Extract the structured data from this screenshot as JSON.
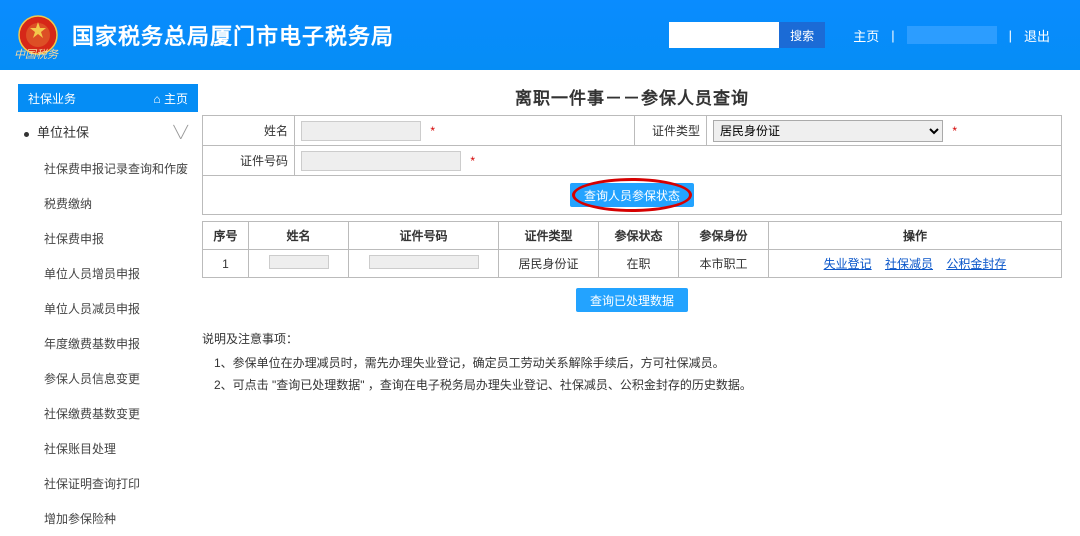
{
  "header": {
    "site_title": "国家税务总局厦门市电子税务局",
    "logo_sub": "中国税务",
    "search_placeholder": "",
    "search_btn": "搜索",
    "nav_home": "主页",
    "nav_logout": "退出"
  },
  "sidebar": {
    "head_label": "社保业务",
    "head_home": "主页",
    "top_item": "单位社保",
    "items": [
      "社保费申报记录查询和作废",
      "税费缴纳",
      "社保费申报",
      "单位人员增员申报",
      "单位人员减员申报",
      "年度缴费基数申报",
      "参保人员信息变更",
      "社保缴费基数变更",
      "社保账目处理",
      "社保证明查询打印",
      "增加参保险种"
    ]
  },
  "page": {
    "title": "离职一件事－－参保人员查询"
  },
  "form": {
    "name_label": "姓名",
    "idtype_label": "证件类型",
    "idtype_value": "居民身份证",
    "idno_label": "证件号码",
    "query_btn": "查询人员参保状态"
  },
  "table": {
    "cols": [
      "序号",
      "姓名",
      "证件号码",
      "证件类型",
      "参保状态",
      "参保身份",
      "操作"
    ],
    "row": {
      "seq": "1",
      "name": "",
      "idno": "",
      "idtype": "居民身份证",
      "status": "在职",
      "identity": "本市职工",
      "ops": [
        "失业登记",
        "社保减员",
        "公积金封存"
      ]
    }
  },
  "processed_btn": "查询已处理数据",
  "notes": {
    "title": "说明及注意事项：",
    "items": [
      "1、参保单位在办理减员时，需先办理失业登记，确定员工劳动关系解除手续后，方可社保减员。",
      "2、可点击 \"查询已处理数据\" ，查询在电子税务局办理失业登记、社保减员、公积金封存的历史数据。"
    ]
  }
}
